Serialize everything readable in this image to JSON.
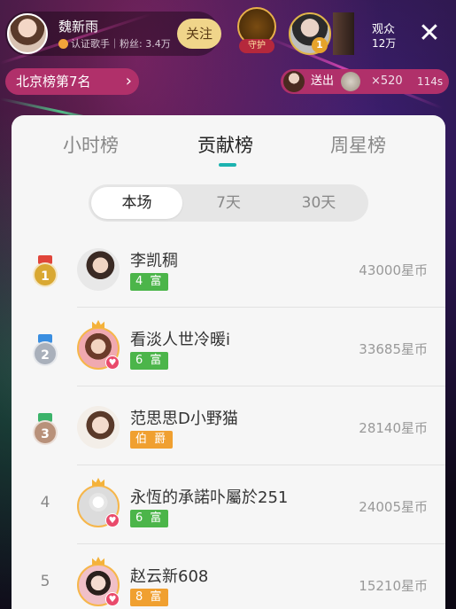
{
  "host": {
    "name": "魏新雨",
    "subtitle": "认证歌手｜粉丝: 3.4万",
    "follow_label": "关注"
  },
  "guard_label": "守护",
  "top_viewer_rank": "1",
  "viewers": {
    "label": "观众",
    "count": "12万"
  },
  "close_symbol": "✕",
  "city_rank": {
    "label": "北京榜第7名",
    "arrow": "›"
  },
  "gift_banner": {
    "sent_label": "送出",
    "count": "×520",
    "time": "114s"
  },
  "colors": {
    "accent": "#1cb3b0",
    "pink": "#b0306a",
    "green_badge": "#4cb54a",
    "orange_badge": "#f0a030"
  },
  "tabs": [
    {
      "label": "小时榜"
    },
    {
      "label": "贡献榜"
    },
    {
      "label": "周星榜"
    }
  ],
  "segments": [
    {
      "label": "本场"
    },
    {
      "label": "7天"
    },
    {
      "label": "30天"
    }
  ],
  "rows": [
    {
      "rank": "1",
      "name": "李凯稠",
      "badge": "4 富",
      "badge_color": "green",
      "coins": "43000星币",
      "medal": "gold"
    },
    {
      "rank": "2",
      "name": "看淡人世冷暖i",
      "badge": "6 富",
      "badge_color": "green",
      "coins": "33685星币",
      "medal": "silver"
    },
    {
      "rank": "3",
      "name": "范思思D小野猫",
      "badge": "伯 爵",
      "badge_color": "orange",
      "coins": "28140星币",
      "medal": "bronze"
    },
    {
      "rank": "4",
      "name": "永恆的承諾卟屬於251",
      "badge": "6 富",
      "badge_color": "green",
      "coins": "24005星币",
      "medal": "none"
    },
    {
      "rank": "5",
      "name": "赵云新608",
      "badge": "8 富",
      "badge_color": "orange",
      "coins": "15210星币",
      "medal": "none"
    }
  ]
}
